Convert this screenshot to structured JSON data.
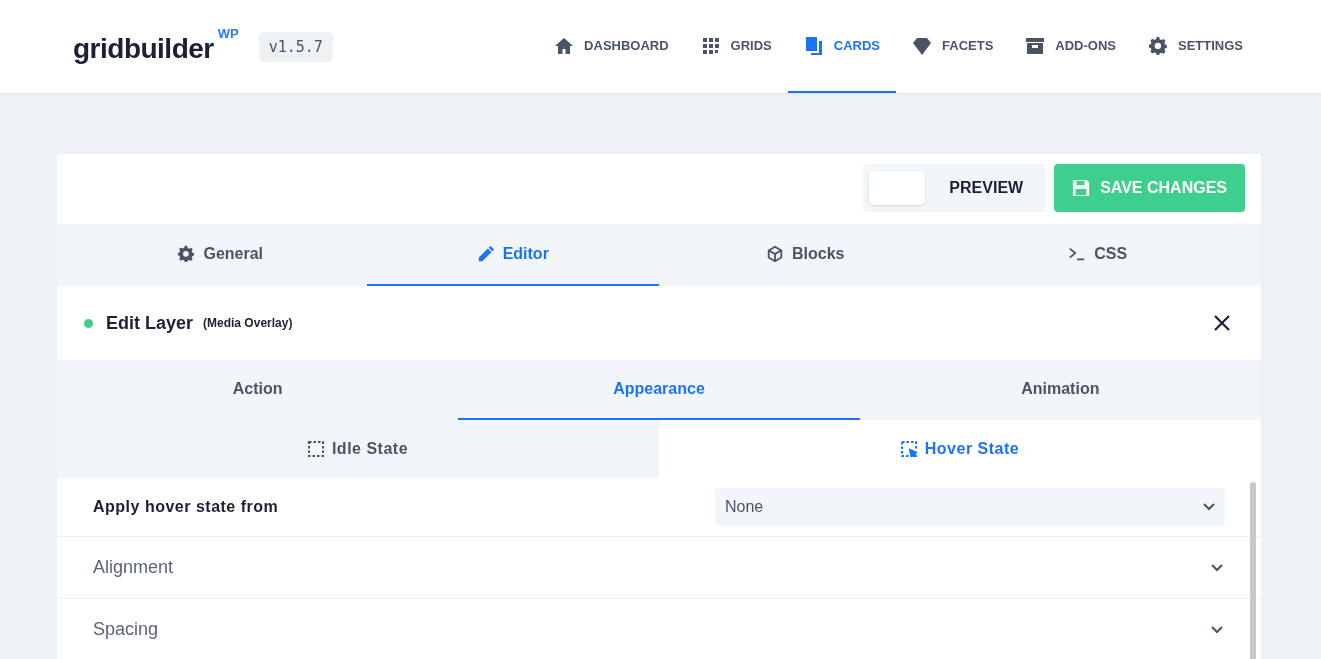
{
  "logo": {
    "name": "gridbuilder",
    "badge": "WP"
  },
  "version": "v1.5.7",
  "nav": [
    {
      "label": "DASHBOARD",
      "selected": false
    },
    {
      "label": "GRIDS",
      "selected": false
    },
    {
      "label": "CARDS",
      "selected": true
    },
    {
      "label": "FACETS",
      "selected": false
    },
    {
      "label": "ADD-ONS",
      "selected": false
    },
    {
      "label": "SETTINGS",
      "selected": false
    }
  ],
  "toolbar": {
    "preview": {
      "label": "PREVIEW",
      "on": false
    },
    "save": "SAVE CHANGES"
  },
  "tabs": [
    {
      "label": "General",
      "selected": false
    },
    {
      "label": "Editor",
      "selected": true
    },
    {
      "label": "Blocks",
      "selected": false
    },
    {
      "label": "CSS",
      "selected": false
    }
  ],
  "layer": {
    "title": "Edit Layer",
    "context": "(Media Overlay)"
  },
  "subtabs": [
    {
      "label": "Action",
      "selected": false
    },
    {
      "label": "Appearance",
      "selected": true
    },
    {
      "label": "Animation",
      "selected": false
    }
  ],
  "state_tabs": [
    {
      "label": "Idle State",
      "selected": false
    },
    {
      "label": "Hover State",
      "selected": true
    }
  ],
  "fields": [
    {
      "kind": "select",
      "label": "Apply hover state from",
      "value": "None"
    },
    {
      "kind": "section",
      "label": "Alignment",
      "expanded": false
    },
    {
      "kind": "section",
      "label": "Spacing",
      "expanded": false
    }
  ]
}
